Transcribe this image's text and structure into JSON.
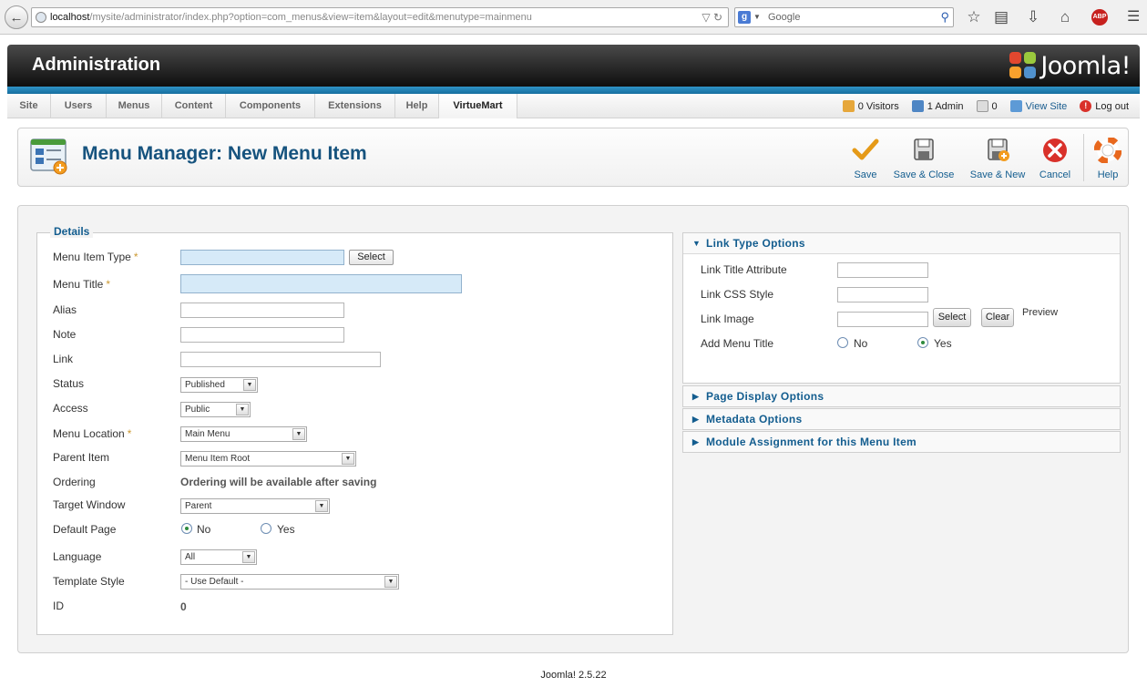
{
  "browser": {
    "url_host": "localhost",
    "url_path": "/mysite/administrator/index.php?option=com_menus&view=item&layout=edit&menutype=mainmenu",
    "search_engine": "g",
    "search_placeholder": "Google"
  },
  "header": {
    "title": "Administration",
    "logo_text": "Joomla!"
  },
  "menubar": {
    "items": [
      "Site",
      "Users",
      "Menus",
      "Content",
      "Components",
      "Extensions",
      "Help",
      "VirtueMart"
    ],
    "active": "VirtueMart",
    "visitors": "0 Visitors",
    "admins": "1 Admin",
    "messages": "0",
    "view_site": "View Site",
    "logout": "Log out"
  },
  "toolbar": {
    "page_title": "Menu Manager: New Menu Item",
    "save": "Save",
    "save_close": "Save & Close",
    "save_new": "Save & New",
    "cancel": "Cancel",
    "help": "Help"
  },
  "details": {
    "legend": "Details",
    "menu_item_type_label": "Menu Item Type",
    "menu_item_type_value": "",
    "select_btn": "Select",
    "menu_title_label": "Menu Title",
    "menu_title_value": "",
    "alias_label": "Alias",
    "alias_value": "",
    "note_label": "Note",
    "note_value": "",
    "link_label": "Link",
    "link_value": "",
    "status_label": "Status",
    "status_value": "Published",
    "access_label": "Access",
    "access_value": "Public",
    "menu_location_label": "Menu Location",
    "menu_location_value": "Main Menu",
    "parent_item_label": "Parent Item",
    "parent_item_value": "Menu Item Root",
    "ordering_label": "Ordering",
    "ordering_text": "Ordering will be available after saving",
    "target_window_label": "Target Window",
    "target_window_value": "Parent",
    "default_page_label": "Default Page",
    "default_page_no": "No",
    "default_page_yes": "Yes",
    "default_page_selected": "No",
    "language_label": "Language",
    "language_value": "All",
    "template_style_label": "Template Style",
    "template_style_value": "- Use Default -",
    "id_label": "ID",
    "id_value": "0",
    "required_marker": "*"
  },
  "link_type_options": {
    "heading": "Link Type Options",
    "link_title_attribute_label": "Link Title Attribute",
    "link_css_style_label": "Link CSS Style",
    "link_image_label": "Link Image",
    "select_btn": "Select",
    "clear_btn": "Clear",
    "preview_label": "Preview",
    "add_menu_title_label": "Add Menu Title",
    "add_menu_title_no": "No",
    "add_menu_title_yes": "Yes",
    "add_menu_title_selected": "Yes"
  },
  "collapsed_panels": [
    "Page Display Options",
    "Metadata Options",
    "Module Assignment for this Menu Item"
  ],
  "footer": {
    "version": "Joomla! 2.5.22"
  },
  "colors": {
    "accent_blue": "#135d8f",
    "required_field_bg": "#d6eaf8",
    "cancel_red": "#d9312a",
    "save_orange": "#e59a18"
  }
}
